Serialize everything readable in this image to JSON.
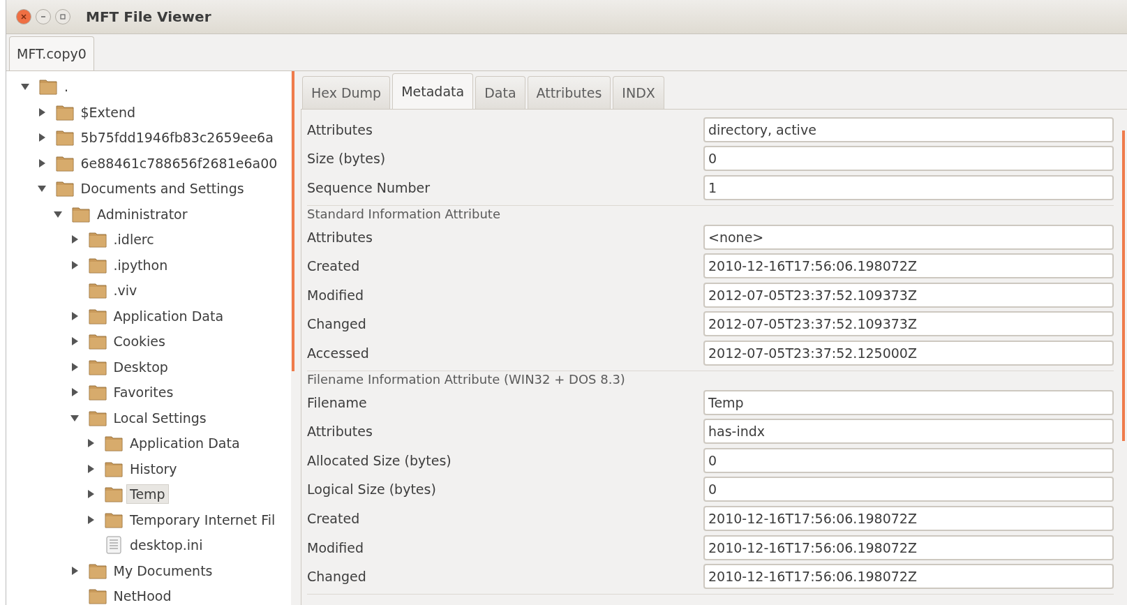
{
  "window": {
    "title": "MFT File Viewer"
  },
  "file_tabs": [
    {
      "label": "MFT.copy0",
      "selected": true
    }
  ],
  "tree": [
    {
      "label": ".",
      "kind": "folder",
      "expanded": true,
      "selected": false,
      "children": [
        {
          "label": "$Extend",
          "kind": "folder",
          "expanded": false,
          "selected": false
        },
        {
          "label": "5b75fdd1946fb83c2659ee6a",
          "kind": "folder",
          "expanded": false,
          "selected": false
        },
        {
          "label": "6e88461c788656f2681e6a00",
          "kind": "folder",
          "expanded": false,
          "selected": false
        },
        {
          "label": "Documents and Settings",
          "kind": "folder",
          "expanded": true,
          "selected": false,
          "children": [
            {
              "label": "Administrator",
              "kind": "folder",
              "expanded": true,
              "selected": false,
              "children": [
                {
                  "label": ".idlerc",
                  "kind": "folder",
                  "expanded": false,
                  "selected": false
                },
                {
                  "label": ".ipython",
                  "kind": "folder",
                  "expanded": false,
                  "selected": false
                },
                {
                  "label": ".viv",
                  "kind": "folder",
                  "selected": false
                },
                {
                  "label": "Application Data",
                  "kind": "folder",
                  "expanded": false,
                  "selected": false
                },
                {
                  "label": "Cookies",
                  "kind": "folder",
                  "expanded": false,
                  "selected": false
                },
                {
                  "label": "Desktop",
                  "kind": "folder",
                  "expanded": false,
                  "selected": false
                },
                {
                  "label": "Favorites",
                  "kind": "folder",
                  "expanded": false,
                  "selected": false
                },
                {
                  "label": "Local Settings",
                  "kind": "folder",
                  "expanded": true,
                  "selected": false,
                  "children": [
                    {
                      "label": "Application Data",
                      "kind": "folder",
                      "expanded": false,
                      "selected": false
                    },
                    {
                      "label": "History",
                      "kind": "folder",
                      "expanded": false,
                      "selected": false
                    },
                    {
                      "label": "Temp",
                      "kind": "folder",
                      "expanded": false,
                      "selected": true
                    },
                    {
                      "label": "Temporary Internet Fil",
                      "kind": "folder",
                      "expanded": false,
                      "selected": false
                    },
                    {
                      "label": "desktop.ini",
                      "kind": "file",
                      "selected": false
                    }
                  ]
                },
                {
                  "label": "My Documents",
                  "kind": "folder",
                  "expanded": false,
                  "selected": false
                },
                {
                  "label": "NetHood",
                  "kind": "folder",
                  "selected": false
                }
              ]
            }
          ]
        }
      ]
    }
  ],
  "detail_tabs": [
    {
      "label": "Hex Dump",
      "selected": false
    },
    {
      "label": "Metadata",
      "selected": true
    },
    {
      "label": "Data",
      "selected": false
    },
    {
      "label": "Attributes",
      "selected": false
    },
    {
      "label": "INDX",
      "selected": false
    }
  ],
  "sections": [
    {
      "rows": [
        {
          "label": "Attributes",
          "value": "directory, active"
        },
        {
          "label": "Size (bytes)",
          "value": "0"
        },
        {
          "label": "Sequence Number",
          "value": "1"
        }
      ]
    },
    {
      "title": "Standard Information Attribute",
      "rows": [
        {
          "label": "Attributes",
          "value": "<none>"
        },
        {
          "label": "Created",
          "value": "2010-12-16T17:56:06.198072Z"
        },
        {
          "label": "Modified",
          "value": "2012-07-05T23:37:52.109373Z"
        },
        {
          "label": "Changed",
          "value": "2012-07-05T23:37:52.109373Z"
        },
        {
          "label": "Accessed",
          "value": "2012-07-05T23:37:52.125000Z"
        }
      ]
    },
    {
      "title": "Filename Information Attribute (WIN32 + DOS 8.3)",
      "rows": [
        {
          "label": "Filename",
          "value": "Temp"
        },
        {
          "label": "Attributes",
          "value": "has-indx"
        },
        {
          "label": "Allocated Size (bytes)",
          "value": "0"
        },
        {
          "label": "Logical Size (bytes)",
          "value": "0"
        },
        {
          "label": "Created",
          "value": "2010-12-16T17:56:06.198072Z"
        },
        {
          "label": "Modified",
          "value": "2010-12-16T17:56:06.198072Z"
        },
        {
          "label": "Changed",
          "value": "2010-12-16T17:56:06.198072Z"
        }
      ]
    }
  ]
}
